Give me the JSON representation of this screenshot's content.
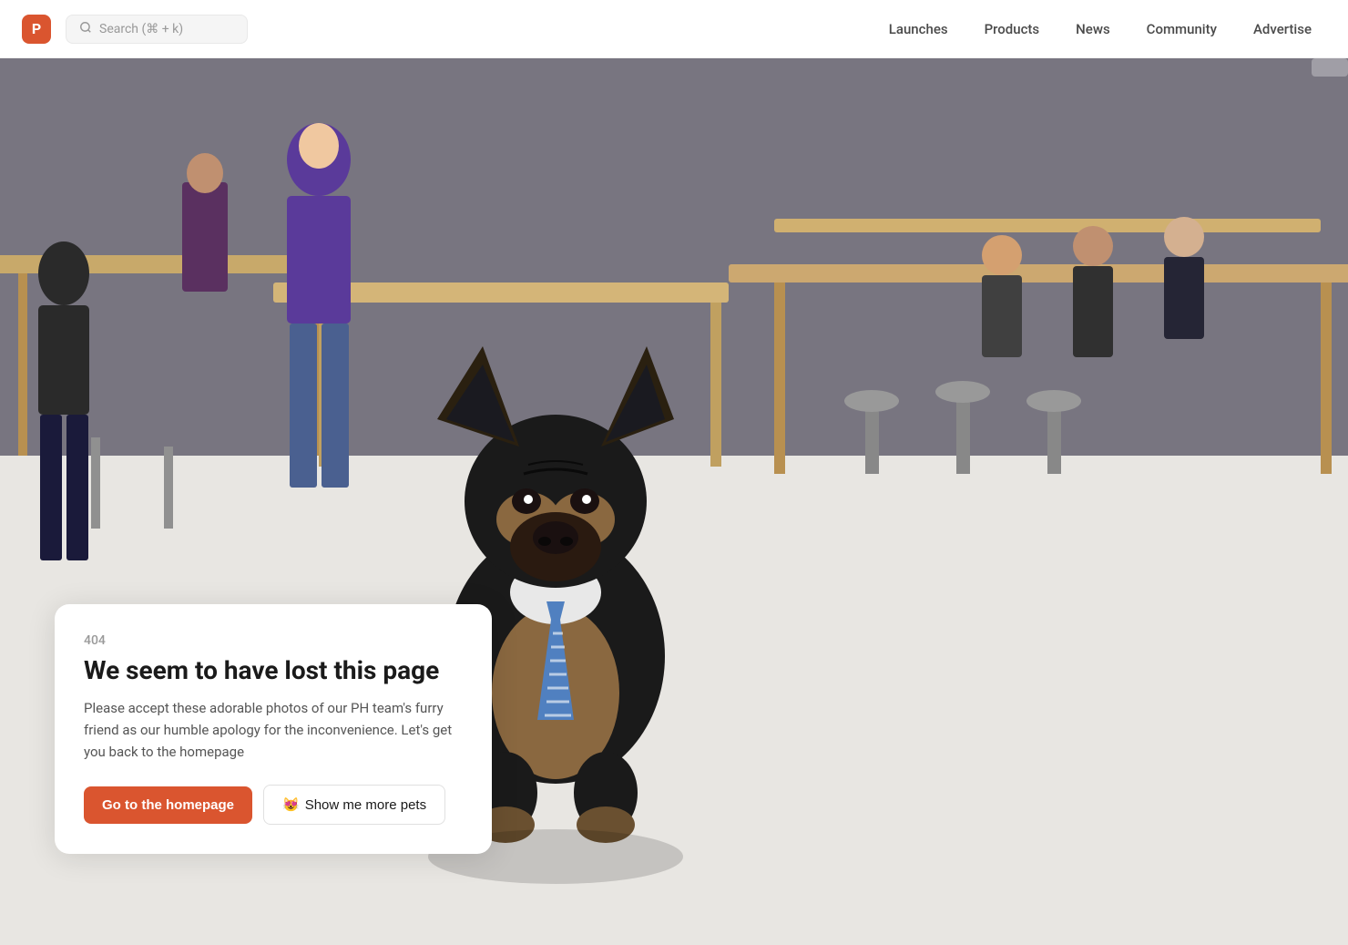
{
  "navbar": {
    "logo_text": "P",
    "search_placeholder": "Search (⌘ + k)",
    "links": [
      {
        "label": "Launches",
        "id": "launches"
      },
      {
        "label": "Products",
        "id": "products"
      },
      {
        "label": "News",
        "id": "news"
      },
      {
        "label": "Community",
        "id": "community"
      },
      {
        "label": "Advertise",
        "id": "advertise"
      }
    ]
  },
  "error": {
    "code": "404",
    "title": "We seem to have lost this page",
    "description": "Please accept these adorable photos of our PH team's furry friend as our humble apology for the inconvenience. Let's get you back to the homepage",
    "btn_primary": "Go to the homepage",
    "btn_secondary_emoji": "😻",
    "btn_secondary": "Show me more pets"
  }
}
